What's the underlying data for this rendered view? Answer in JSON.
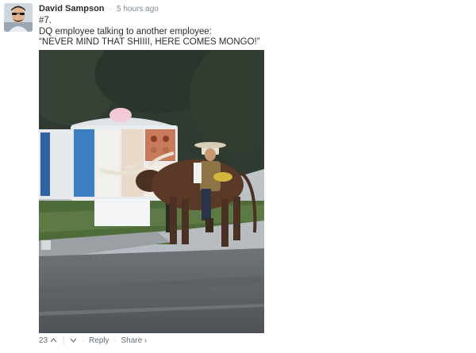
{
  "comment": {
    "author": "David Sampson",
    "time_separator": "·",
    "timestamp": "5 hours ago",
    "lines": [
      "#7.",
      "DQ employee talking to another employee:",
      "“NEVER MIND THAT SHIIII, HERE COMES MONGO!”"
    ],
    "image_icon": "photo-cowboy-on-longhorn-at-drive-thru"
  },
  "footer": {
    "upvotes": "23",
    "upvote_icon": "chevron-up-icon",
    "vote_divider": "|",
    "downvote_icon": "chevron-down-icon",
    "separator": "·",
    "reply_label": "Reply",
    "share_label": "Share ›"
  },
  "colors": {
    "author": "#2a2e2e",
    "meta": "#7f8c93",
    "footer": "#656c7a"
  }
}
